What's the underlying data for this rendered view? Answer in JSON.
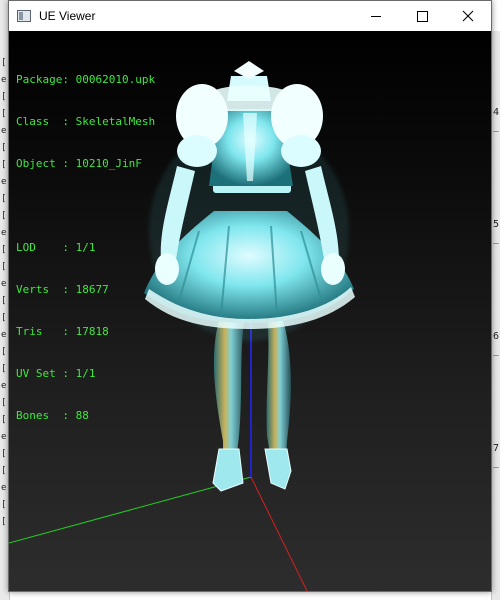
{
  "window": {
    "title": "UE Viewer",
    "icon": "app-window-icon",
    "controls": [
      "minimize",
      "maximize",
      "close"
    ]
  },
  "info": {
    "rows1": [
      {
        "label": "Package",
        "value": "00062010.upk"
      },
      {
        "label": "Class  ",
        "value": "SkeletalMesh"
      },
      {
        "label": "Object ",
        "value": "10210_JinF"
      }
    ],
    "rows2": [
      {
        "label": "LOD    ",
        "value": "1/1"
      },
      {
        "label": "Verts  ",
        "value": "18677"
      },
      {
        "label": "Tris   ",
        "value": "17818"
      },
      {
        "label": "UV Set ",
        "value": "1/1"
      },
      {
        "label": "Bones  ",
        "value": "88"
      }
    ]
  },
  "background_app": {
    "left_glyphs": [
      "[",
      "e",
      "[",
      "[",
      "e",
      "[",
      "[",
      "e",
      "[",
      "[",
      "e",
      "[",
      "[",
      "e",
      "[",
      "[",
      "e",
      "[",
      "[",
      "e",
      "[",
      "[",
      "e",
      "[",
      "[",
      "e",
      "[",
      "["
    ],
    "right_glyphs": [
      "4",
      "_",
      "5",
      "_",
      "6",
      "_",
      "7",
      "_"
    ]
  },
  "colors": {
    "info_text": "#3fe83f",
    "mesh": "#7fe6ee",
    "axis_x": "#d42020",
    "axis_y": "#22cc22",
    "axis_z": "#2222cc"
  }
}
